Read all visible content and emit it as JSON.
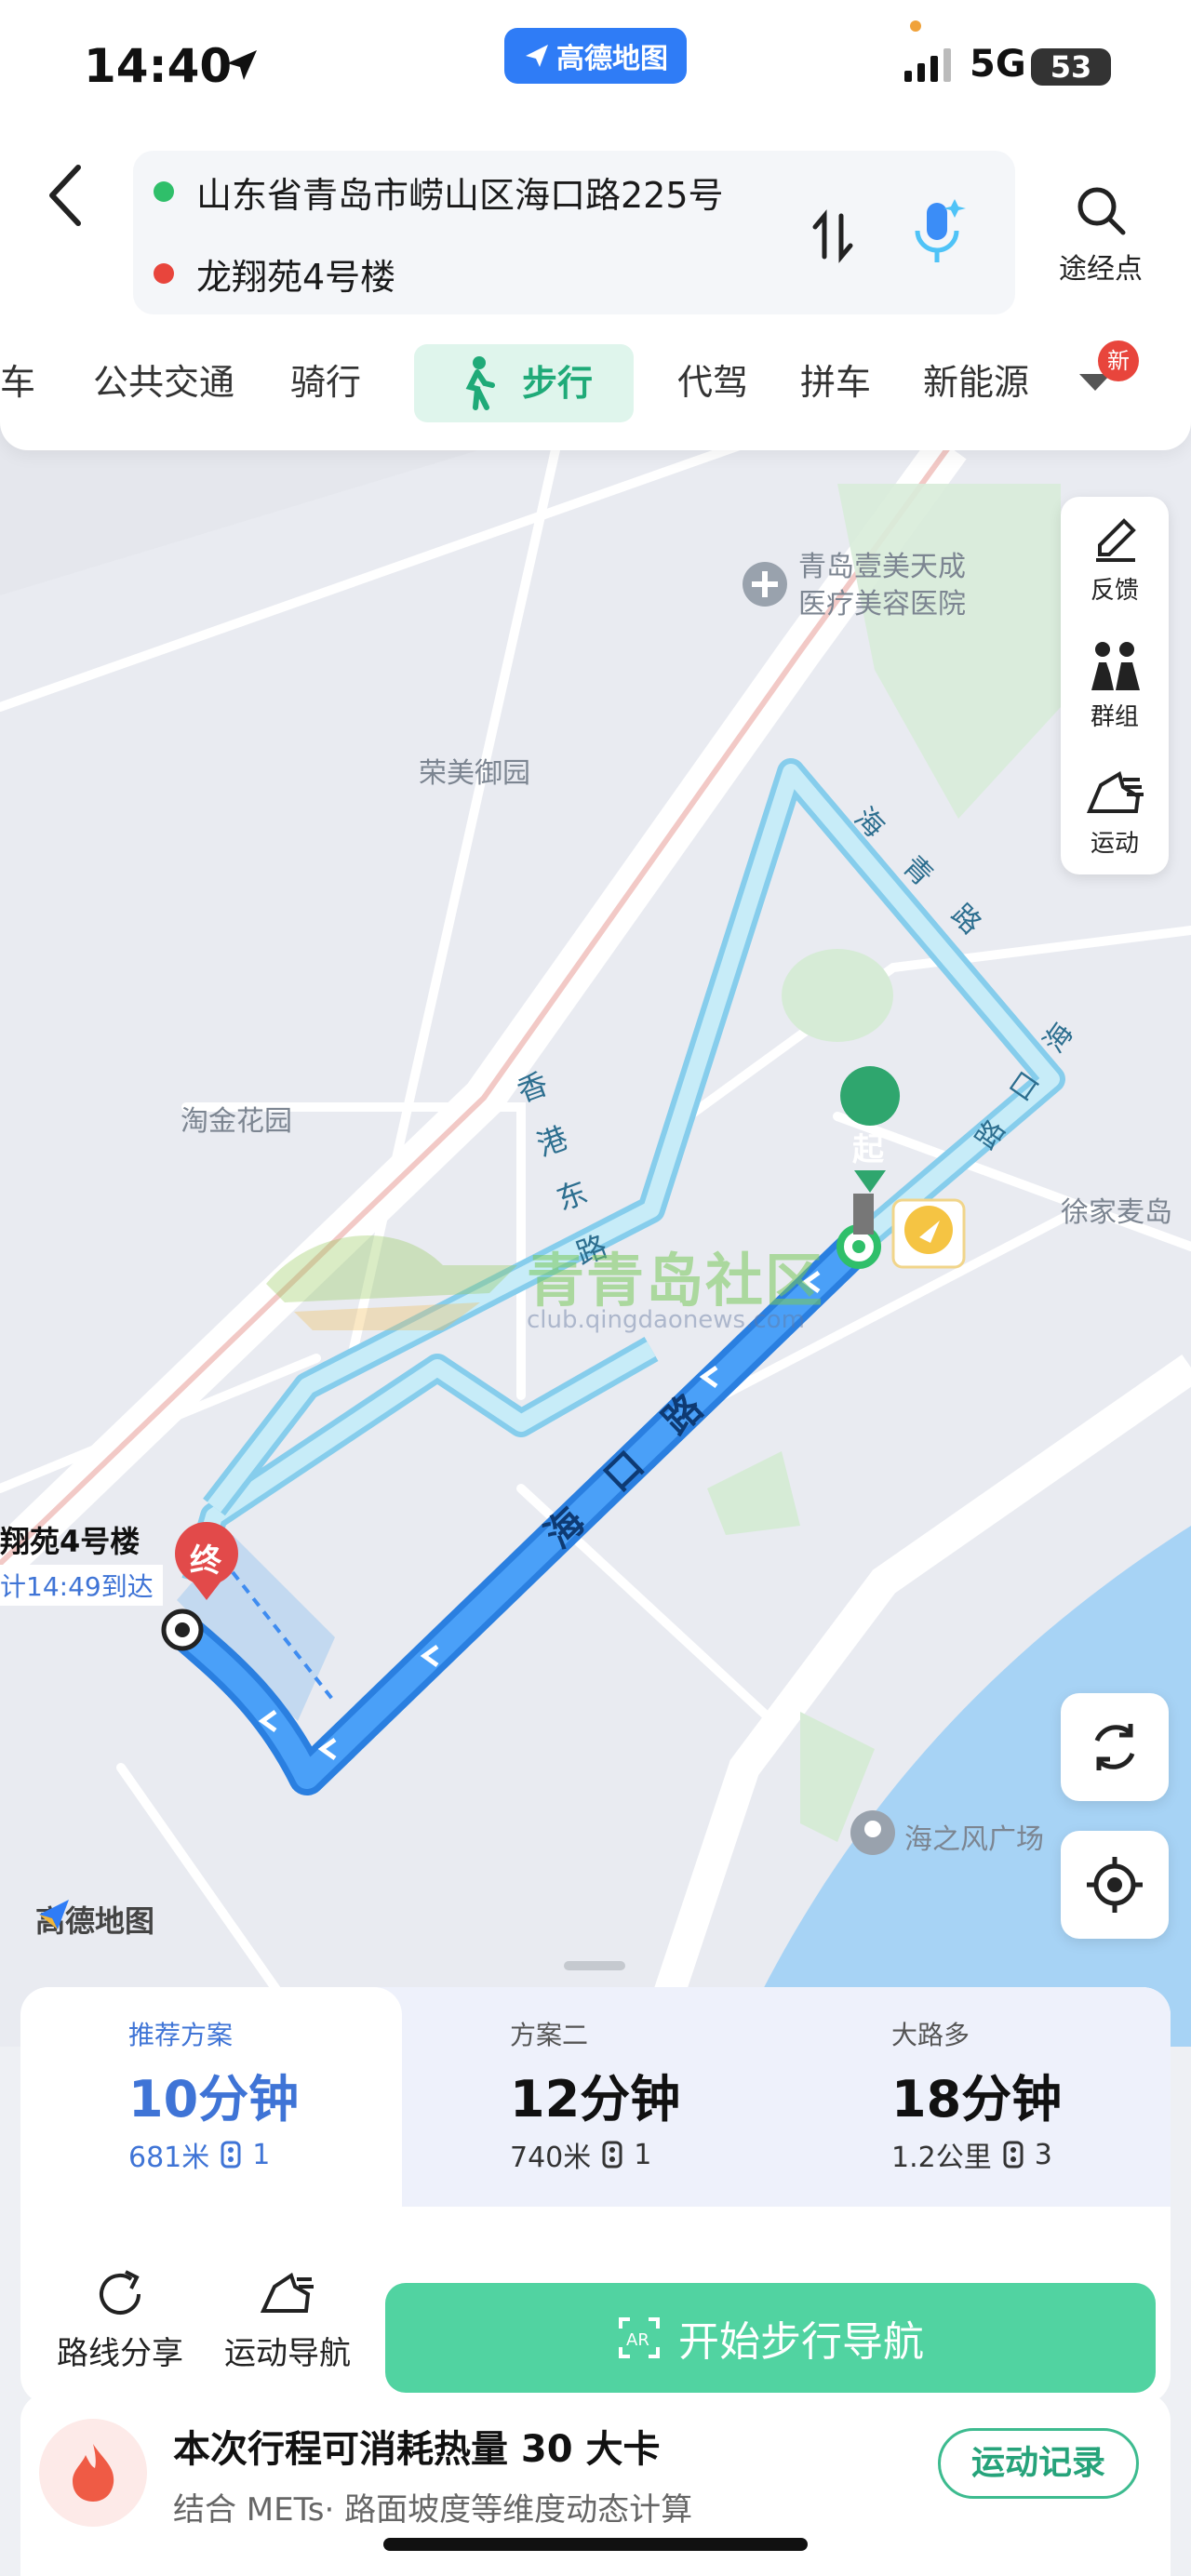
{
  "status_bar": {
    "time": "14:40",
    "app_pill": "高德地图",
    "network": "5G",
    "battery": "53"
  },
  "header": {
    "origin": "山东省青岛市崂山区海口路225号",
    "destination": "龙翔苑4号楼",
    "waypoint_label": "途经点",
    "colors": {
      "origin_dot": "#2fbf6a",
      "destination_dot": "#e8453c",
      "accent": "#1faa78"
    }
  },
  "tabs": [
    {
      "label": "车"
    },
    {
      "label": "公共交通"
    },
    {
      "label": "骑行"
    },
    {
      "label": "步行",
      "selected": true
    },
    {
      "label": "代驾"
    },
    {
      "label": "拼车"
    },
    {
      "label": "新能源"
    }
  ],
  "new_badge": "新",
  "map": {
    "labels": {
      "hospital": "青岛壹美天成\n医疗美容医院",
      "rongmei": "荣美御园",
      "taojin": "淘金花园",
      "xujiamai": "徐家麦岛",
      "haizhifeng": "海之风广场",
      "dest_name": "翔苑4号楼",
      "dest_eta": "计14:49到达"
    },
    "road_labels": {
      "haiqing": [
        "海",
        "青",
        "路"
      ],
      "haikou_upper": [
        "路",
        "口",
        "海"
      ],
      "xianggangdong": [
        "香",
        "港",
        "东",
        "路"
      ],
      "haikou_lower": [
        "海",
        "口",
        "路"
      ]
    },
    "start_marker": "起",
    "end_marker": "终",
    "logo": "高德地图"
  },
  "watermark": {
    "text": "青青岛社区",
    "url": "club.qingdaonews.com"
  },
  "tools": [
    {
      "label": "反馈",
      "icon": "feedback-icon"
    },
    {
      "label": "群组",
      "icon": "group-icon"
    },
    {
      "label": "运动",
      "icon": "sport-icon"
    }
  ],
  "plans": [
    {
      "name": "推荐方案",
      "time": "10分钟",
      "distance": "681米",
      "lights": "1",
      "selected": true
    },
    {
      "name": "方案二",
      "time": "12分钟",
      "distance": "740米",
      "lights": "1"
    },
    {
      "name": "大路多",
      "time": "18分钟",
      "distance": "1.2公里",
      "lights": "3"
    }
  ],
  "actions": {
    "share": "路线分享",
    "sport_nav": "运动导航",
    "start": "开始步行导航"
  },
  "calorie": {
    "title": "本次行程可消耗热量 30 大卡",
    "subtitle": "结合 METs· 路面坡度等维度动态计算",
    "record": "运动记录"
  }
}
